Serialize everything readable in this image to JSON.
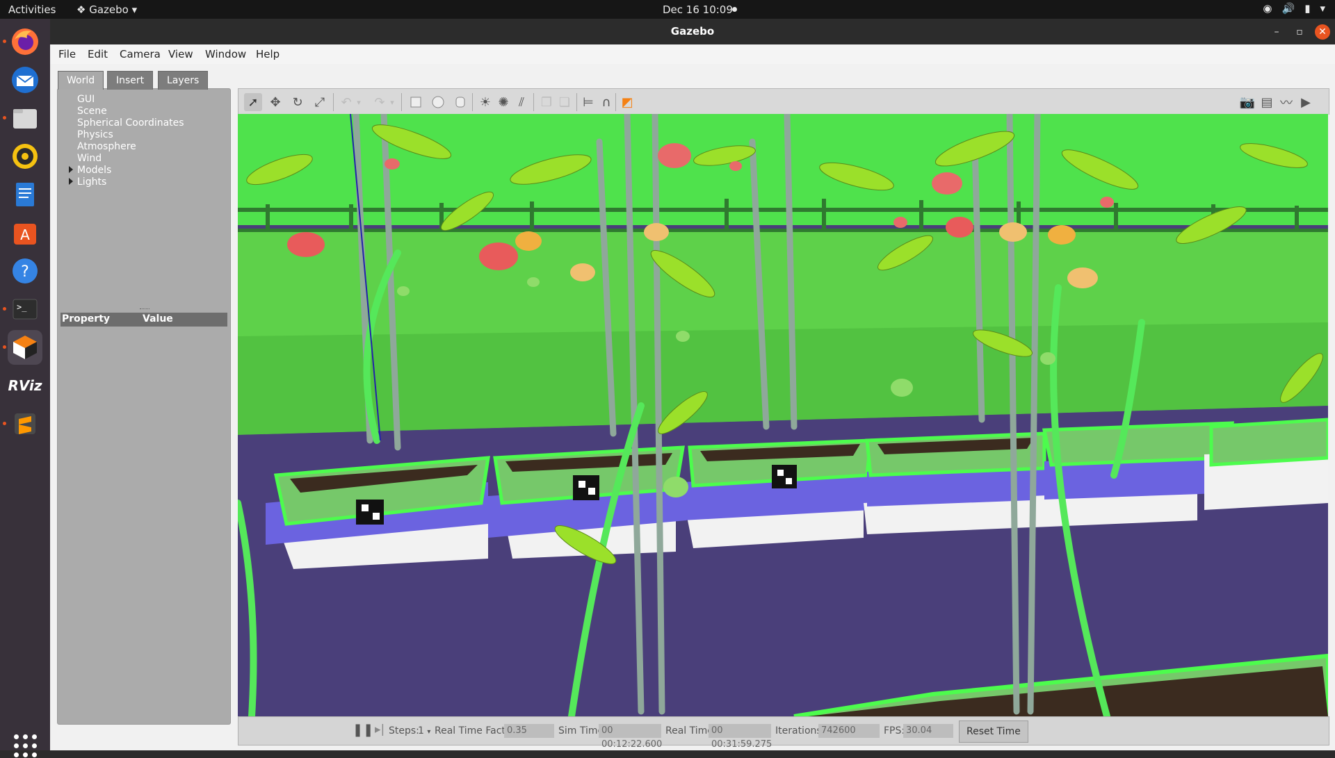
{
  "topbar": {
    "activities": "Activities",
    "app_menu": "Gazebo",
    "clock": "Dec 16  10:09"
  },
  "window": {
    "title": "Gazebo",
    "minimize": "–",
    "maximize": "▫",
    "close": "✕"
  },
  "menu": {
    "file": "File",
    "edit": "Edit",
    "camera": "Camera",
    "view": "View",
    "window": "Window",
    "help": "Help"
  },
  "left_panel": {
    "tabs": [
      "World",
      "Insert",
      "Layers"
    ],
    "tree": [
      "GUI",
      "Scene",
      "Spherical Coordinates",
      "Physics",
      "Atmosphere",
      "Wind",
      "Models",
      "Lights"
    ],
    "property_header": "Property",
    "value_header": "Value"
  },
  "bottom_bar": {
    "steps_label": "Steps:",
    "steps_value": "1",
    "rtf_label": "Real Time Factor:",
    "rtf_value": "0.35",
    "sim_time_label": "Sim Time:",
    "sim_time_value": "00 00:12:22.600",
    "real_time_label": "Real Time:",
    "real_time_value": "00 00:31:59.275",
    "iterations_label": "Iterations:",
    "iterations_value": "742600",
    "fps_label": "FPS:",
    "fps_value": "30.04",
    "reset_button": "Reset Time"
  },
  "dock": {
    "rviz_label": "RViz"
  },
  "colors": {
    "accent": "#e95420",
    "sky": "#4fe24c",
    "ground": "#4a3f7a"
  }
}
